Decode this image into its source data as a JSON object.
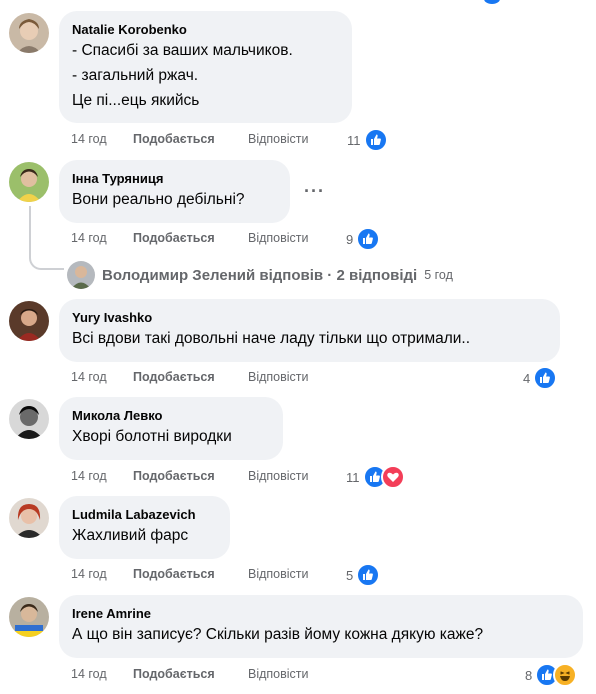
{
  "comments": [
    {
      "author": "Natalie Korobenko",
      "lines": [
        "- Спасибі за ваших мальчиков.",
        "- загальний ржач.",
        "Це пі...ець якийсь"
      ],
      "time": "14 год",
      "like_label": "Подобається",
      "reply_label": "Відповісти",
      "reaction_count": "11",
      "reactions": [
        "like"
      ]
    },
    {
      "author": "Інна Туряниця",
      "lines": [
        "Вони реально дебільні?"
      ],
      "time": "14 год",
      "like_label": "Подобається",
      "reply_label": "Відповісти",
      "reaction_count": "9",
      "reactions": [
        "like"
      ],
      "more_icon": "more-horizontal-icon",
      "more_label": "···",
      "replies": {
        "text": "Володимир Зелений відповів · 2 відповіді",
        "time": "5 год"
      }
    },
    {
      "author": "Yury Ivashko",
      "lines": [
        "Всі вдови такі довольні наче ладу тільки що отримали.."
      ],
      "time": "14 год",
      "like_label": "Подобається",
      "reply_label": "Відповісти",
      "reaction_count": "4",
      "reactions": [
        "like"
      ]
    },
    {
      "author": "Микола Левко",
      "lines": [
        "Хворі болотні виродки"
      ],
      "time": "14 год",
      "like_label": "Подобається",
      "reply_label": "Відповісти",
      "reaction_count": "11",
      "reactions": [
        "like",
        "love"
      ]
    },
    {
      "author": "Ludmila Labazevich",
      "lines": [
        "Жахливий фарс"
      ],
      "time": "14 год",
      "like_label": "Подобається",
      "reply_label": "Відповісти",
      "reaction_count": "5",
      "reactions": [
        "like"
      ]
    },
    {
      "author": "Irene Amrine",
      "lines": [
        "А що він записує? Скільки разів йому кожна дякую каже?"
      ],
      "time": "14 год",
      "like_label": "Подобається",
      "reply_label": "Відповісти",
      "reaction_count": "8",
      "reactions": [
        "like",
        "haha"
      ]
    }
  ],
  "colors": {
    "bubble": "#f0f2f5",
    "meta_text": "#65676b",
    "like_blue": "#1877f2",
    "love_red": "#f33e58",
    "haha_yellow": "#f7b125"
  }
}
